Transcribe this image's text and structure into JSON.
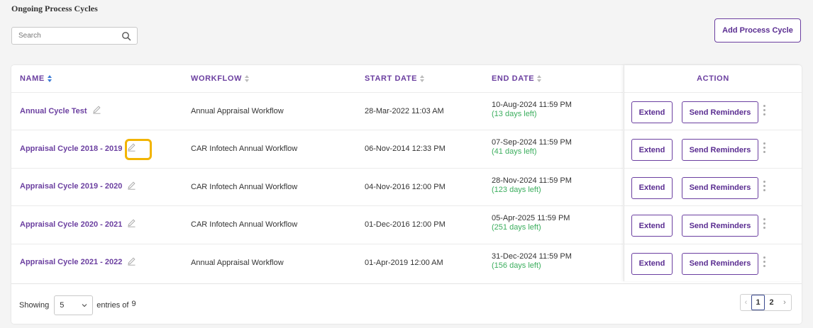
{
  "page_title": "Ongoing Process Cycles",
  "search": {
    "placeholder": "Search"
  },
  "add_button": "Add Process Cycle",
  "columns": {
    "name": "NAME",
    "workflow": "WORKFLOW",
    "start_date": "START DATE",
    "end_date": "END DATE",
    "action": "ACTION"
  },
  "rows": [
    {
      "name": "Annual Cycle Test",
      "workflow": "Annual Appraisal Workflow",
      "start": "28-Mar-2022 11:03 AM",
      "end": "10-Aug-2024 11:59 PM",
      "left": "(13 days left)"
    },
    {
      "name": "Appraisal Cycle 2018 - 2019",
      "workflow": "CAR Infotech Annual Workflow",
      "start": "06-Nov-2014 12:33 PM",
      "end": "07-Sep-2024 11:59 PM",
      "left": "(41 days left)"
    },
    {
      "name": "Appraisal Cycle 2019 - 2020",
      "workflow": "CAR Infotech Annual Workflow",
      "start": "04-Nov-2016 12:00 PM",
      "end": "28-Nov-2024 11:59 PM",
      "left": "(123 days left)"
    },
    {
      "name": "Appraisal Cycle 2020 - 2021",
      "workflow": "CAR Infotech Annual Workflow",
      "start": "01-Dec-2016 12:00 PM",
      "end": "05-Apr-2025 11:59 PM",
      "left": "(251 days left)"
    },
    {
      "name": "Appraisal Cycle 2021 - 2022",
      "workflow": "Annual Appraisal Workflow",
      "start": "01-Apr-2019 12:00 AM",
      "end": "31-Dec-2024 11:59 PM",
      "left": "(156 days left)"
    }
  ],
  "actions": {
    "extend": "Extend",
    "send_reminders": "Send Reminders"
  },
  "footer": {
    "showing": "Showing",
    "page_size": "5",
    "entries_of": "entries of",
    "total": "9"
  },
  "pagination": {
    "prev": "‹",
    "pages": [
      "1",
      "2"
    ],
    "current": "1",
    "next": "›"
  },
  "colors": {
    "accent": "#6b3fa0",
    "days_left": "#3cae5e",
    "highlight": "#f2b400"
  },
  "icons": {
    "search": "search-icon",
    "edit": "pencil-icon",
    "sort": "sort-icon",
    "more": "kebab-icon",
    "dropdown": "chevron-down-icon"
  }
}
